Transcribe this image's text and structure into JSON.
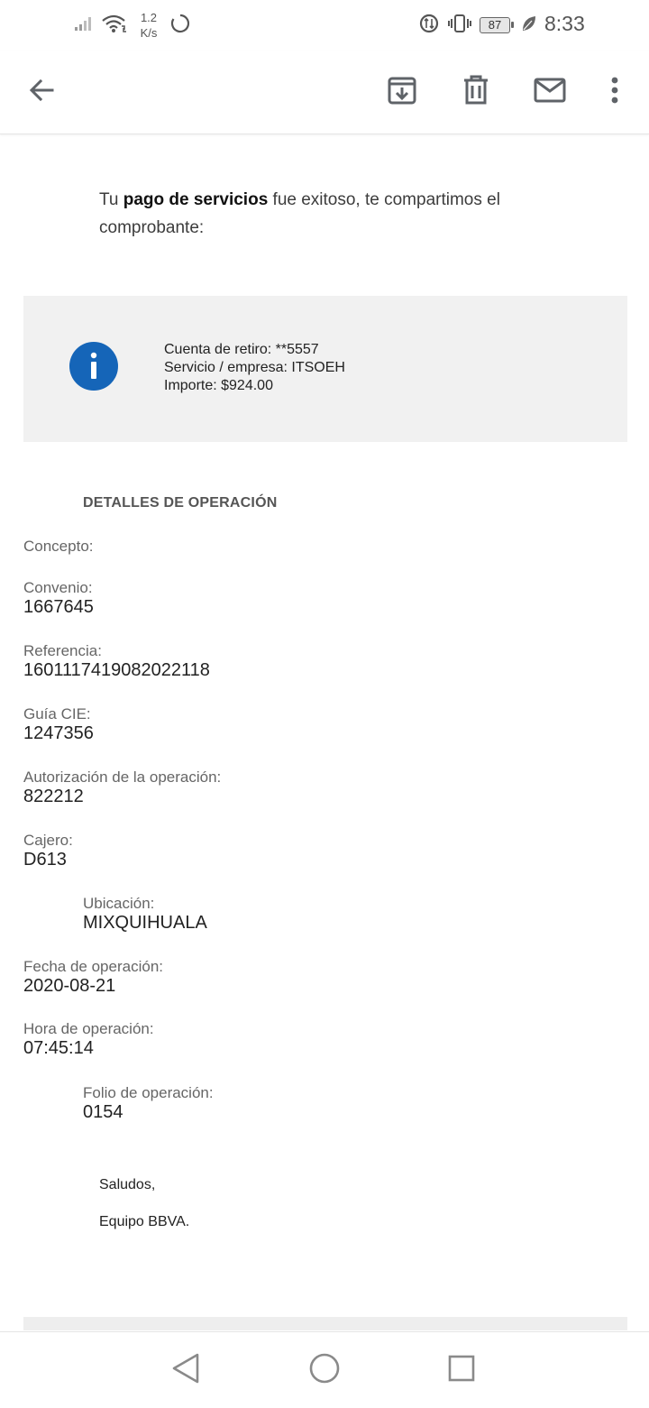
{
  "status_bar": {
    "net_speed_value": "1.2",
    "net_speed_unit": "K/s",
    "battery": "87",
    "time": "8:33",
    "icons": [
      "signal-icon",
      "wifi-icon",
      "sync-icon",
      "data-saver-icon",
      "vibrate-icon",
      "battery-icon",
      "leaf-icon"
    ]
  },
  "app_bar": {
    "icons": [
      "back-arrow-icon",
      "archive-icon",
      "trash-icon",
      "mail-icon",
      "more-vert-icon"
    ]
  },
  "email": {
    "intro_pre": "Tu ",
    "intro_bold": "pago de servicios",
    "intro_post": " fue exitoso, te compartimos el comprobante:",
    "info_box": {
      "account_line": "Cuenta de retiro: **5557",
      "service_line": "Servicio / empresa: ITSOEH",
      "amount_line": "Importe: $924.00"
    },
    "section_title": "DETALLES DE OPERACIÓN",
    "details": [
      {
        "label": "Concepto:",
        "value": ""
      },
      {
        "label": "Convenio:",
        "value": "1667645"
      },
      {
        "label": "Referencia:",
        "value": "1601117419082022118"
      },
      {
        "label": "Guía CIE:",
        "value": "1247356"
      },
      {
        "label": "Autorización de la operación:",
        "value": "822212"
      },
      {
        "label": "Cajero:",
        "value": "D613"
      },
      {
        "label": "Ubicación:",
        "value": "MIXQUIHUALA"
      },
      {
        "label": "Fecha de operación:",
        "value": "2020-08-21"
      },
      {
        "label": "Hora de operación:",
        "value": "07:45:14"
      },
      {
        "label": "Folio de operación:",
        "value": "0154"
      }
    ],
    "signoff": {
      "greeting": "Saludos,",
      "team": "Equipo BBVA."
    }
  },
  "colors": {
    "info_icon": "#1565b8",
    "info_box_bg": "#f1f1f1",
    "icon_grey": "#5f6368"
  }
}
